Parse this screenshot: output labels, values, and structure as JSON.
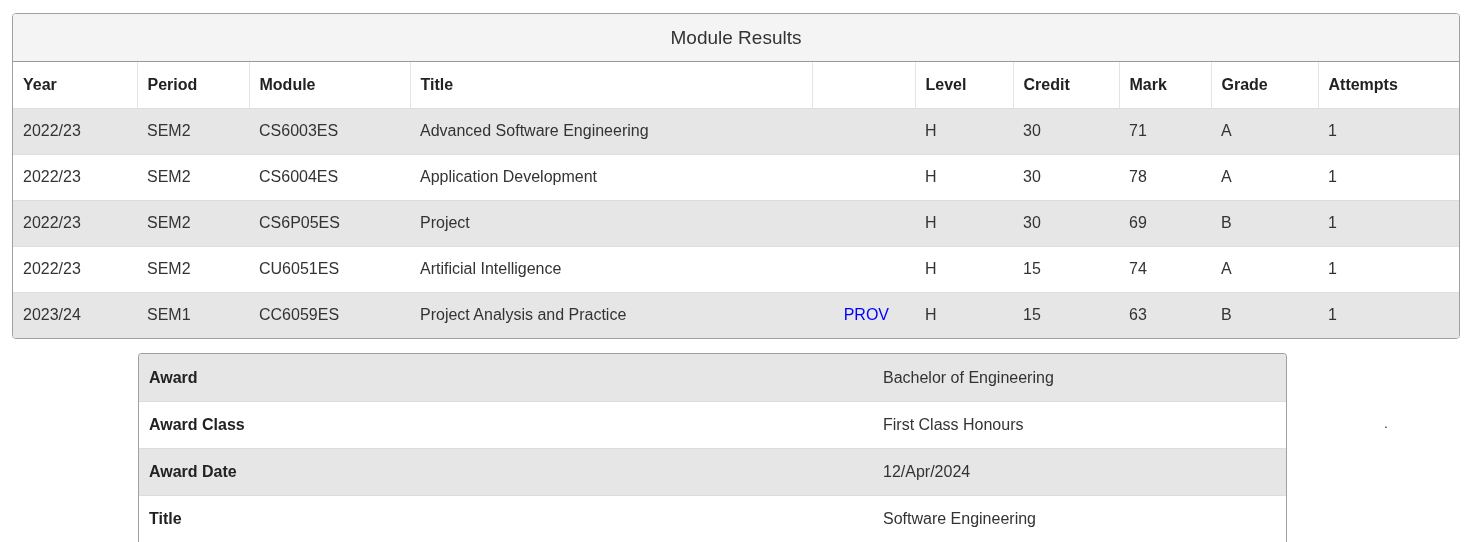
{
  "module_results": {
    "title": "Module Results",
    "columns": [
      "Year",
      "Period",
      "Module",
      "Title",
      "Level",
      "Credit",
      "Mark",
      "Grade",
      "Attempts"
    ],
    "rows": [
      {
        "cells": [
          "2022/23",
          "SEM2",
          "CS6003ES",
          "Advanced Software Engineering",
          "H",
          "30",
          "71",
          "A",
          "1"
        ]
      },
      {
        "cells": [
          "2022/23",
          "SEM2",
          "CS6004ES",
          "Application Development",
          "H",
          "30",
          "78",
          "A",
          "1"
        ]
      },
      {
        "cells": [
          "2022/23",
          "SEM2",
          "CS6P05ES",
          "Project",
          "H",
          "30",
          "69",
          "B",
          "1"
        ]
      },
      {
        "cells": [
          "2022/23",
          "SEM2",
          "CU6051ES",
          "Artificial Intelligence",
          "H",
          "15",
          "74",
          "A",
          "1"
        ]
      },
      {
        "cells": [
          "2023/24",
          "SEM1",
          "CC6059ES",
          "Project Analysis and Practice",
          "H",
          "15",
          "63",
          "B",
          "1"
        ],
        "status": "PROV"
      }
    ]
  },
  "award": {
    "rows": [
      {
        "label": "Award",
        "value": "Bachelor of Engineering"
      },
      {
        "label": "Award Class",
        "value": "First Class Honours"
      },
      {
        "label": "Award Date",
        "value": "12/Apr/2024"
      },
      {
        "label": "Title",
        "value": "Software Engineering"
      }
    ]
  },
  "stray_mark": "."
}
